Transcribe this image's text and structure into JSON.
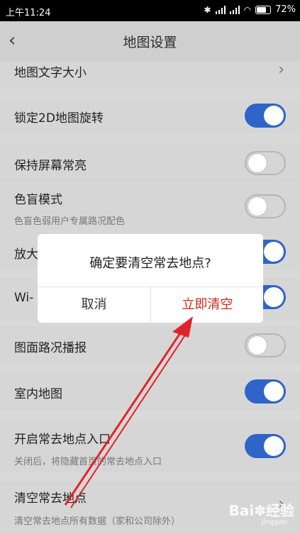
{
  "status": {
    "time": "上午11:24",
    "battery": "72%"
  },
  "header": {
    "title": "地图设置"
  },
  "settings": [
    {
      "label": "地图文字大小",
      "type": "link"
    },
    {
      "label": "锁定2D地图旋转",
      "type": "toggle",
      "on": true
    },
    {
      "label": "保持屏幕常亮",
      "type": "toggle",
      "on": false
    },
    {
      "label": "色盲模式",
      "sub": "色盲色弱用户专属路况配色",
      "type": "toggle",
      "on": false
    },
    {
      "label": "放大",
      "type": "toggle",
      "on": true
    },
    {
      "label": "Wi-",
      "type": "toggle",
      "on": true
    },
    {
      "label": "图面路况播报",
      "type": "toggle",
      "on": false
    },
    {
      "label": "室内地图",
      "type": "toggle",
      "on": true
    },
    {
      "label": "开启常去地点入口",
      "sub": "关闭后，将隐藏首页的常去地点入口",
      "type": "toggle",
      "on": true
    },
    {
      "label": "清空常去地点",
      "sub": "清空常去地点所有数据（家和公司除外）",
      "type": "link"
    }
  ],
  "dialog": {
    "message": "确定要清空常去地点?",
    "cancel": "取消",
    "confirm": "立即清空"
  },
  "watermark": {
    "brand": "Bai",
    "sub": "jingyan",
    "suffix": "经验"
  },
  "colors": {
    "toggle_on": "#2f64c9",
    "confirm_red": "#d5261c",
    "arrow_red": "#e0242c"
  }
}
